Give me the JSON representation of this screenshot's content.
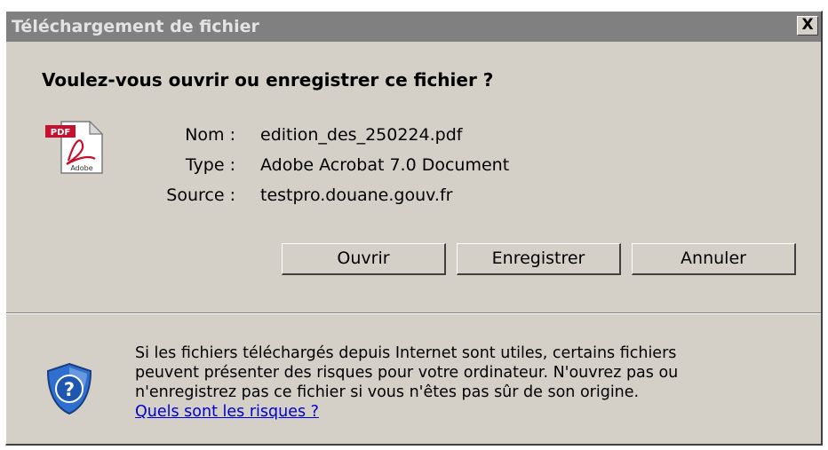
{
  "dialog": {
    "title": "Téléchargement de fichier",
    "close_label": "X",
    "question": "Voulez-vous ouvrir ou enregistrer ce fichier ?"
  },
  "file_info": {
    "name_label": "Nom :",
    "name_value": "edition_des_250224.pdf",
    "type_label": "Type :",
    "type_value": "Adobe Acrobat 7.0 Document",
    "source_label": "Source :",
    "source_value": "testpro.douane.gouv.fr"
  },
  "icons": {
    "file_icon": "pdf-icon",
    "file_icon_badge": "PDF",
    "file_icon_caption": "Adobe",
    "warning_icon": "shield-question-icon",
    "warning_icon_glyph": "?"
  },
  "buttons": {
    "open_label": "Ouvrir",
    "save_label": "Enregistrer",
    "cancel_label": "Annuler"
  },
  "warning": {
    "text": "Si les fichiers téléchargés depuis Internet sont utiles, certains fichiers\npeuvent présenter des risques pour votre ordinateur. N'ouvrez pas ou\nn'enregistrez pas ce fichier si vous n'êtes pas sûr de son origine.",
    "link_label": "Quels sont les risques ?"
  },
  "colors": {
    "dialog_bg": "#d4d0c8",
    "titlebar_bg": "#808080",
    "link": "#0000cc",
    "pdf_red": "#c8102e",
    "shield_blue": "#2f6fd0"
  }
}
